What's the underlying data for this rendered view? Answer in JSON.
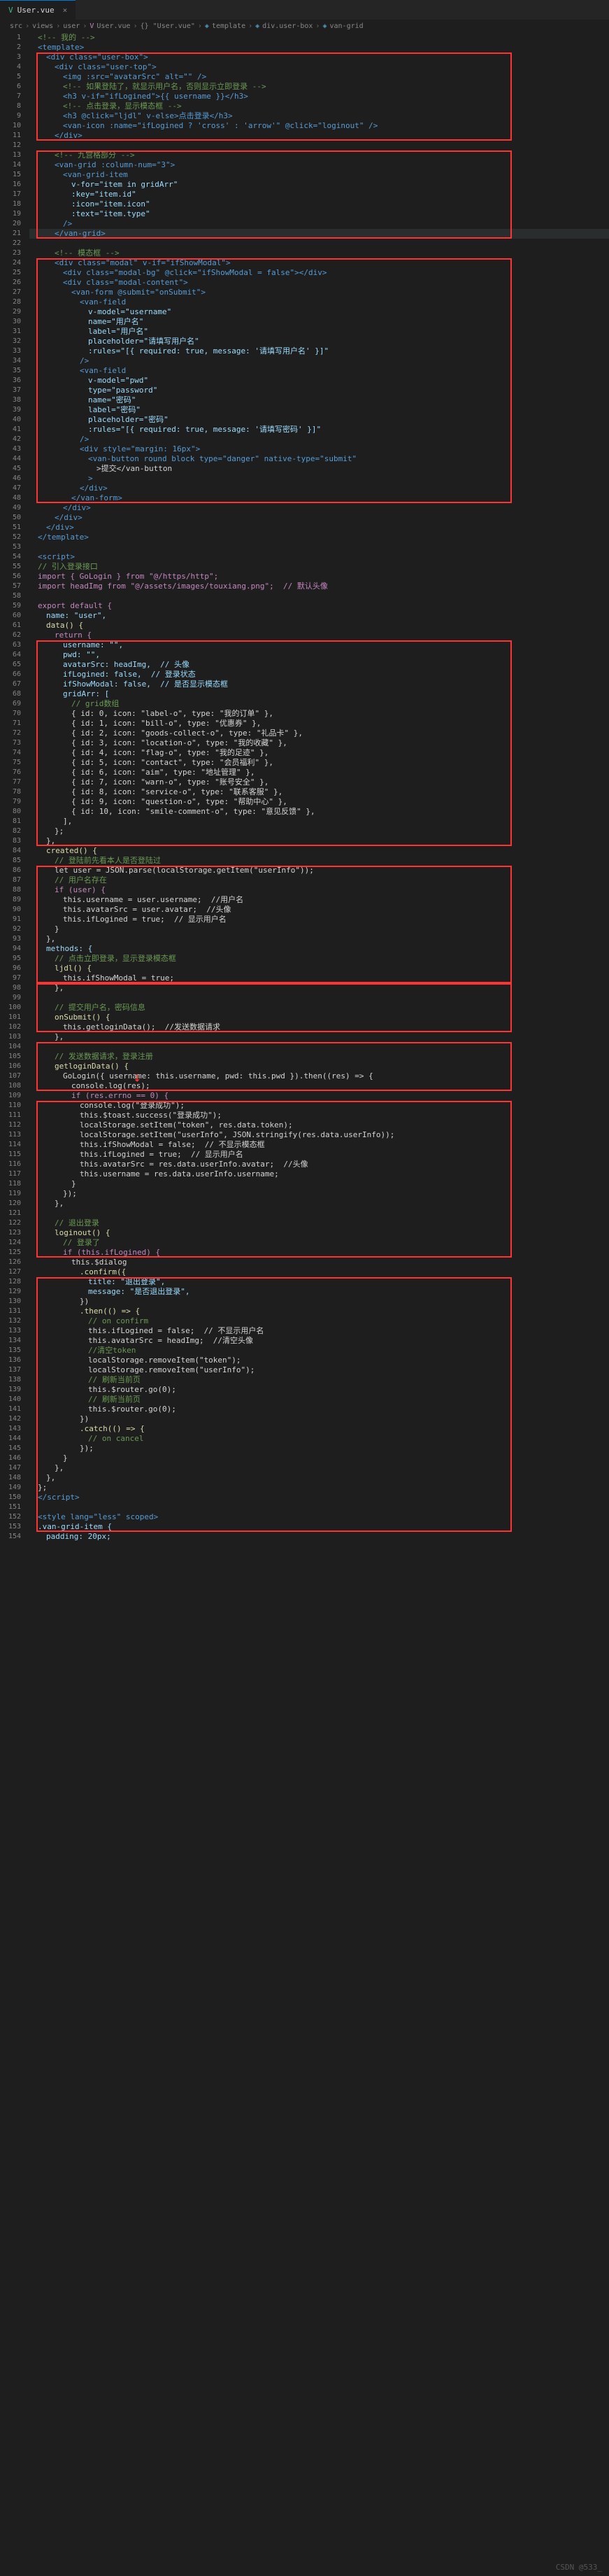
{
  "tab": {
    "filename": "User.vue",
    "icon": "V"
  },
  "breadcrumb": {
    "parts": [
      "src",
      "views",
      "user",
      "User.vue",
      "{} \"User.vue\"",
      "template",
      "div.user-box",
      "van-grid"
    ]
  },
  "watermark": "CSDN @533_",
  "code": {
    "l1": "<!-- 我的 -->",
    "l2": "<template>",
    "l3": "<div class=\"user-box\">",
    "l4": "<div class=\"user-top\">",
    "l5": "<img :src=\"avatarSrc\" alt=\"\" />",
    "l6": "<!-- 如果登陆了，就显示用户名，否则显示立即登录 -->",
    "l7": "<h3 v-if=\"ifLogined\">{{ username }}</h3>",
    "l8": "<!-- 点击登录，显示模态框 -->",
    "l9": "<h3 @click=\"ljdl\" v-else>点击登录</h3>",
    "l10": "<van-icon :name=\"ifLogined ? 'cross' : 'arrow'\" @click=\"loginout\" />",
    "l11": "</div>",
    "l12": "",
    "l13": "<!-- 九宫格部分 -->",
    "l14": "<van-grid :column-num=\"3\">",
    "l15": "<van-grid-item",
    "l16": "v-for=\"item in gridArr\"",
    "l17": ":key=\"item.id\"",
    "l18": ":icon=\"item.icon\"",
    "l19": ":text=\"item.type\"",
    "l20": "/>",
    "l21": "</van-grid>",
    "l22": "",
    "l23": "<!-- 模态框 -->",
    "l24": "<div class=\"modal\" v-if=\"ifShowModal\">",
    "l25": "<div class=\"modal-bg\" @click=\"ifShowModal = false\"></div>",
    "l26": "<div class=\"modal-content\">",
    "l27": "<van-form @submit=\"onSubmit\">",
    "l28": "<van-field",
    "l29": "v-model=\"username\"",
    "l30": "name=\"用户名\"",
    "l31": "label=\"用户名\"",
    "l32": "placeholder=\"请填写用户名\"",
    "l33": ":rules=\"[{ required: true, message: '请填写用户名' }]\"",
    "l34": "/>",
    "l35": "<van-field",
    "l36": "v-model=\"pwd\"",
    "l37": "type=\"password\"",
    "l38": "name=\"密码\"",
    "l39": "label=\"密码\"",
    "l40": "placeholder=\"密码\"",
    "l41": ":rules=\"[{ required: true, message: '请填写密码' }]\"",
    "l42": "/>",
    "l43": "<div style=\"margin: 16px\">",
    "l44": "<van-button round block type=\"danger\" native-type=\"submit\"",
    "l45": ">提交</van-button",
    "l46": ">",
    "l47": "</div>",
    "l48": "</van-form>",
    "l49": "</div>",
    "l50": "</div>",
    "l51": "</div>",
    "l52": "</template>",
    "l53": "",
    "l54": "<script>",
    "l55": "// 引入登录接口",
    "l56": "import { GoLogin } from \"@/https/http\";",
    "l57": "import headImg from \"@/assets/images/touxiang.png\";  // 默认头像",
    "l58": "",
    "l59": "export default {",
    "l60": "name: \"user\",",
    "l61": "data() {",
    "l62": "return {",
    "l63": "username: \"\",",
    "l64": "pwd: \"\",",
    "l65": "avatarSrc: headImg,  // 头像",
    "l66": "ifLogined: false,  // 登录状态",
    "l67": "ifShowModal: false,  // 是否显示模态框",
    "l68": "gridArr: [",
    "l69": "// grid数组",
    "l70": "{ id: 0, icon: \"label-o\", type: \"我的订单\" },",
    "l71": "{ id: 1, icon: \"bill-o\", type: \"优惠券\" },",
    "l72": "{ id: 2, icon: \"goods-collect-o\", type: \"礼品卡\" },",
    "l73": "{ id: 3, icon: \"location-o\", type: \"我的收藏\" },",
    "l74": "{ id: 4, icon: \"flag-o\", type: \"我的足迹\" },",
    "l75": "{ id: 5, icon: \"contact\", type: \"会员福利\" },",
    "l76": "{ id: 6, icon: \"aim\", type: \"地址管理\" },",
    "l77": "{ id: 7, icon: \"warn-o\", type: \"账号安全\" },",
    "l78": "{ id: 8, icon: \"service-o\", type: \"联系客服\" },",
    "l79": "{ id: 9, icon: \"question-o\", type: \"帮助中心\" },",
    "l80": "{ id: 10, icon: \"smile-comment-o\", type: \"意见反馈\" },",
    "l81": "],",
    "l82": "};",
    "l83": "},",
    "l84": "created() {",
    "l85": "// 登陆前先看本人是否登陆过",
    "l86": "let user = JSON.parse(localStorage.getItem(\"userInfo\"));",
    "l87": "// 用户名存在",
    "l88": "if (user) {",
    "l89": "this.username = user.username;  //用户名",
    "l90": "this.avatarSrc = user.avatar;  //头像",
    "l91": "this.ifLogined = true;  // 显示用户名",
    "l92": "}",
    "l93": "},",
    "l94": "methods: {",
    "l95": "// 点击立即登录，显示登录模态框",
    "l96": "ljdl() {",
    "l97": "this.ifShowModal = true;",
    "l98": "},",
    "l99": "",
    "l100": "// 提交用户名，密码信息",
    "l101": "onSubmit() {",
    "l102": "this.getloginData();  //发送数据请求",
    "l103": "},",
    "l104": "",
    "l105": "// 发送数据请求，登录注册",
    "l106": "getloginData() {",
    "l107": "GoLogin({ username: this.username, pwd: this.pwd }).then((res) => {",
    "l108": "console.log(res);",
    "l109": "if (res.errno == 0) {",
    "l110": "console.log(\"登录成功\");",
    "l111": "this.$toast.success(\"登录成功\");",
    "l112": "localStorage.setItem(\"token\", res.data.token);",
    "l113": "localStorage.setItem(\"userInfo\", JSON.stringify(res.data.userInfo));",
    "l114": "this.ifShowModal = false;  // 不显示模态框",
    "l115": "this.ifLogined = true;  // 显示用户名",
    "l116": "this.avatarSrc = res.data.userInfo.avatar;  //头像",
    "l117": "this.username = res.data.userInfo.username;",
    "l118": "}",
    "l119": "});",
    "l120": "},",
    "l121": "",
    "l122": "// 退出登录",
    "l123": "loginout() {",
    "l124": "// 登录了",
    "l125": "if (this.ifLogined) {",
    "l126": "this.$dialog",
    "l127": ".confirm({",
    "l128": "title: \"退出登录\",",
    "l129": "message: \"是否退出登录\",",
    "l130": "})",
    "l131": ".then(() => {",
    "l132": "// on confirm",
    "l133": "this.ifLogined = false;  // 不显示用户名",
    "l134": "this.avatarSrc = headImg;  //清空头像",
    "l135": "//清空token",
    "l136": "localStorage.removeItem(\"token\");",
    "l137": "localStorage.removeItem(\"userInfo\");",
    "l138": "// 刷新当前页",
    "l139": "this.$router.go(0);",
    "l140": "// 刷新当前页",
    "l141": "this.$router.go(0);",
    "l142": "})",
    "l143": ".catch(() => {",
    "l144": "// on cancel",
    "l145": "});",
    "l146": "}",
    "l147": "},",
    "l148": "},",
    "l149": "};",
    "l150": "</script>",
    "l151": "",
    "l152": "<style lang=\"less\" scoped>",
    "l153": ".van-grid-item {",
    "l154": "padding: 20px;"
  }
}
